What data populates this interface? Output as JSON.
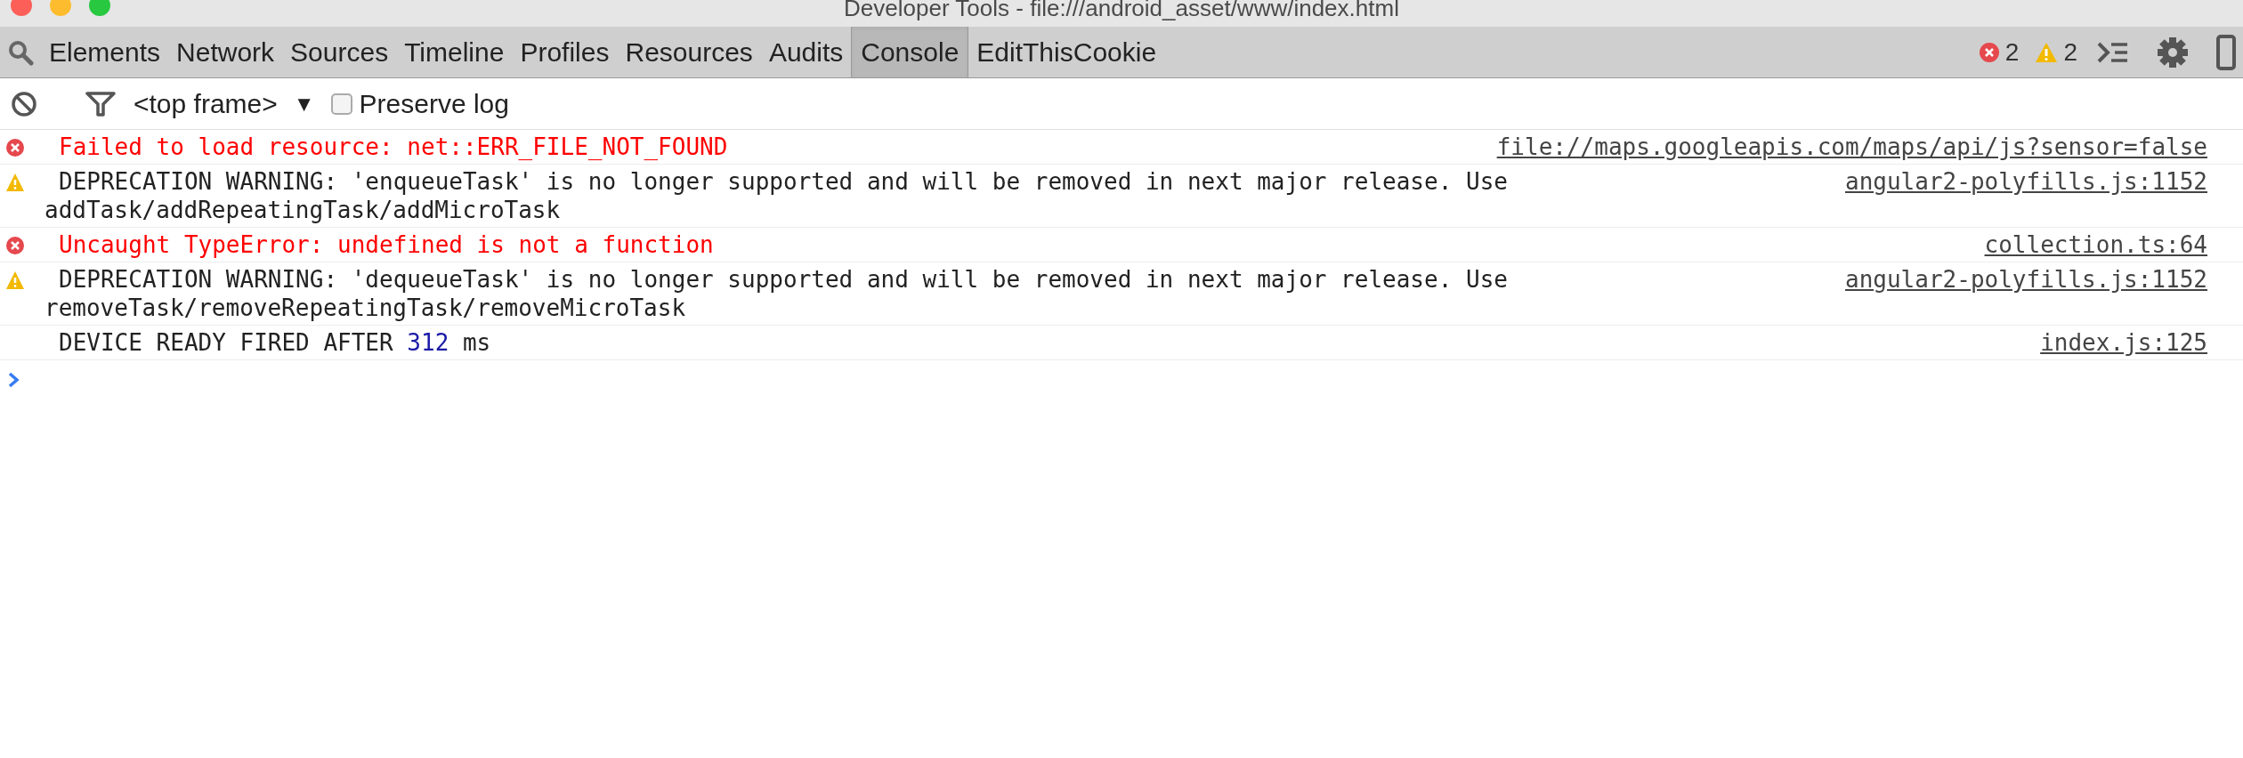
{
  "window": {
    "title": "Developer Tools - file:///android_asset/www/index.html"
  },
  "tabs": [
    {
      "label": "Elements",
      "selected": false
    },
    {
      "label": "Network",
      "selected": false
    },
    {
      "label": "Sources",
      "selected": false
    },
    {
      "label": "Timeline",
      "selected": false
    },
    {
      "label": "Profiles",
      "selected": false
    },
    {
      "label": "Resources",
      "selected": false
    },
    {
      "label": "Audits",
      "selected": false
    },
    {
      "label": "Console",
      "selected": true
    },
    {
      "label": "EditThisCookie",
      "selected": false
    }
  ],
  "counts": {
    "errors": "2",
    "warnings": "2"
  },
  "toolbar": {
    "context": "<top frame>",
    "dropdown_arrow": "▼",
    "preserve_log": {
      "label": "Preserve log",
      "checked": false
    }
  },
  "messages": [
    {
      "kind": "error",
      "text": "Failed to load resource: net::ERR_FILE_NOT_FOUND",
      "source": "file://maps.googleapis.com/maps/api/js?sensor=false"
    },
    {
      "kind": "warning",
      "text": "DEPRECATION WARNING: 'enqueueTask' is no longer supported and will be removed in next major release. Use addTask/addRepeatingTask/addMicroTask",
      "source": "angular2-polyfills.js:1152"
    },
    {
      "kind": "error",
      "text": "Uncaught TypeError: undefined is not a function",
      "source": "collection.ts:64"
    },
    {
      "kind": "warning",
      "text": "DEPRECATION WARNING: 'dequeueTask' is no longer supported and will be removed in next major release. Use removeTask/removeRepeatingTask/removeMicroTask",
      "source": "angular2-polyfills.js:1152"
    },
    {
      "kind": "log",
      "text": "DEVICE READY FIRED AFTER ",
      "number": "312",
      "text_after": " ms",
      "source": "index.js:125"
    }
  ]
}
